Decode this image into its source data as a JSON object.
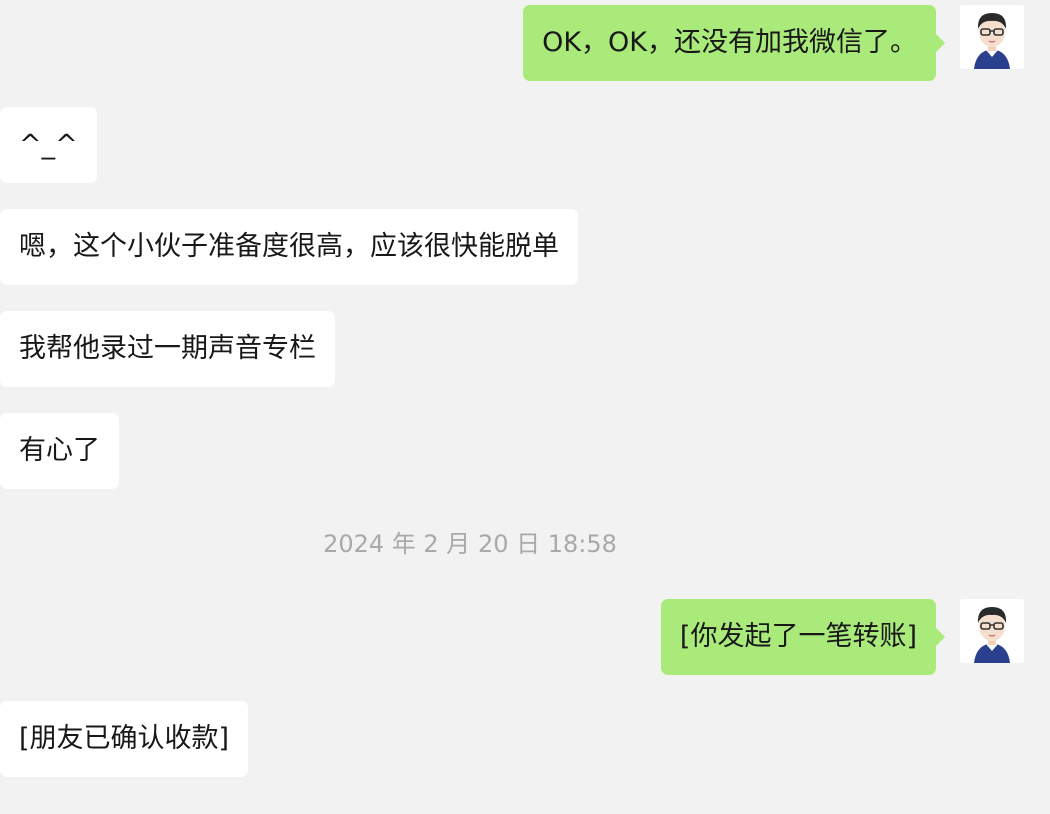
{
  "messages": [
    {
      "side": "out",
      "text": "OK，OK，还没有加我微信了。"
    },
    {
      "side": "in",
      "text": "^_^"
    },
    {
      "side": "in",
      "text": "嗯，这个小伙子准备度很高，应该很快能脱单"
    },
    {
      "side": "in",
      "text": "我帮他录过一期声音专栏"
    },
    {
      "side": "in",
      "text": "有心了"
    },
    {
      "side": "out",
      "text": "[你发起了一笔转账]"
    },
    {
      "side": "in",
      "text": "[朋友已确认收款]"
    }
  ],
  "timestamp": "2024 年 2 月 20 日 18:58",
  "avatar_icon": "cartoon-man-glasses-avatar",
  "colors": {
    "background": "#f2f2f2",
    "outgoing_bubble": "#a9ea7a",
    "incoming_bubble": "#ffffff",
    "timestamp_text": "#a9a9a9"
  }
}
